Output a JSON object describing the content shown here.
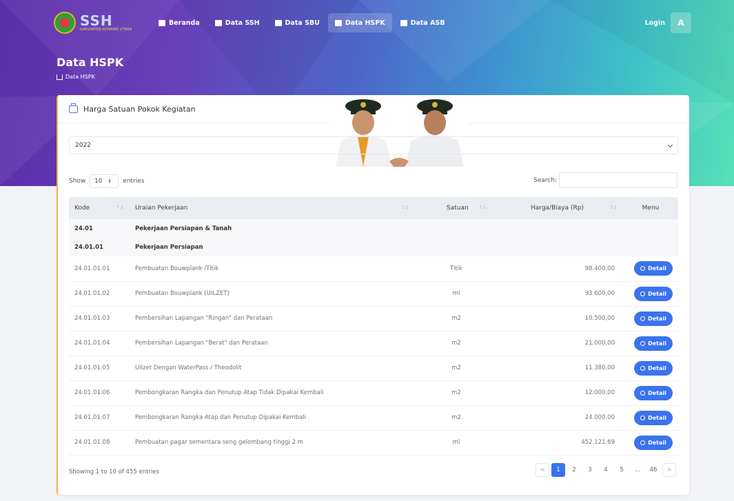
{
  "brand": {
    "name": "SSH",
    "subtitle": "KABUPATEN KONAWE UTARA"
  },
  "nav": [
    {
      "label": "Beranda",
      "icon": "home-icon",
      "active": false
    },
    {
      "label": "Data SSH",
      "icon": "box-icon",
      "active": false
    },
    {
      "label": "Data SBU",
      "icon": "car-icon",
      "active": false
    },
    {
      "label": "Data HSPK",
      "icon": "grid-icon",
      "active": true
    },
    {
      "label": "Data ASB",
      "icon": "document-icon",
      "active": false
    }
  ],
  "login": {
    "label": "Login",
    "avatar": "A"
  },
  "page": {
    "title": "Data HSPK",
    "breadcrumb": "Data HSPK"
  },
  "card": {
    "title": "Harga Satuan Pokok Kegiatan"
  },
  "year_select": {
    "value": "2022"
  },
  "length": {
    "show": "Show",
    "value": "10",
    "entries": "entries"
  },
  "search": {
    "label": "Search:",
    "value": ""
  },
  "table": {
    "headers": [
      "Kode",
      "Uraian Pekerjaan",
      "Satuan",
      "Harga/Biaya (Rp)",
      "Menu"
    ],
    "groups": [
      {
        "code": "24.01",
        "name": "Pekerjaan Persiapan & Tanah"
      },
      {
        "code": "24.01.01",
        "name": "Pekerjaan Persiapan"
      }
    ],
    "rows": [
      {
        "code": "24.01.01.01",
        "desc": "Pembuatan Bouwplank /Titik",
        "unit": "Titik",
        "price": "98.400,00"
      },
      {
        "code": "24.01.01.02",
        "desc": "Pembuatan Bouwplank (UILZET)",
        "unit": "ml",
        "price": "93.600,00"
      },
      {
        "code": "24.01.01.03",
        "desc": "Pembersihan Lapangan \"Ringan\" dan Perataan",
        "unit": "m2",
        "price": "10.500,00"
      },
      {
        "code": "24.01.01.04",
        "desc": "Pembersihan Lapangan \"Berat\" dan Perataan",
        "unit": "m2",
        "price": "21.000,00"
      },
      {
        "code": "24.01.01.05",
        "desc": "Uilzet Dengan WaterPass / Theodolit",
        "unit": "m2",
        "price": "11.380,00"
      },
      {
        "code": "24.01.01.06",
        "desc": "Pembongkaran Rangka dan Penutup Atap Tidak Dipakai Kembali",
        "unit": "m2",
        "price": "12.000,00"
      },
      {
        "code": "24.01.01.07",
        "desc": "Pembongkaran Rangka Atap dan Penutup Dipakai Kembali",
        "unit": "m2",
        "price": "24.000,00"
      },
      {
        "code": "24.01.01.08",
        "desc": "Pembuatan pagar sementara seng gelombang tinggi 2 m",
        "unit": "ml",
        "price": "452.121,69"
      }
    ],
    "detail_label": "Detail"
  },
  "info": "Showing 1 to 10 of 455 entries",
  "pagination": {
    "prev": "<",
    "pages": [
      "1",
      "2",
      "3",
      "4",
      "5",
      "...",
      "46"
    ],
    "next": ">",
    "active": "1"
  },
  "colors": {
    "primary": "#3b73ee",
    "accent": "#f5b04a"
  }
}
